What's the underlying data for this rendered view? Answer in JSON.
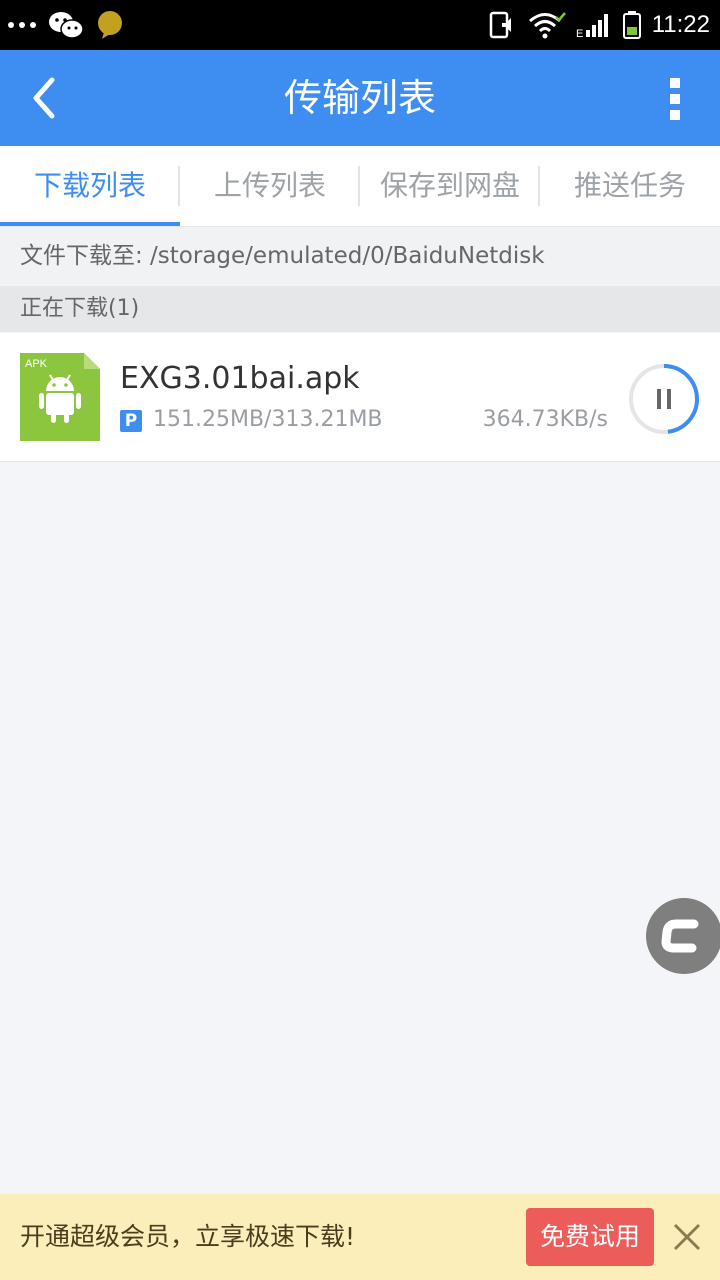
{
  "status_bar": {
    "time": "11:22",
    "icons": [
      "more-dots-icon",
      "wechat-icon",
      "chat-bubble-icon",
      "phone-vibrate-icon",
      "wifi-icon",
      "signal-icon",
      "battery-icon"
    ]
  },
  "app_bar": {
    "title": "传输列表",
    "back_icon": "back-arrow-icon",
    "menu_icon": "more-vertical-icon"
  },
  "tabs": [
    {
      "label": "下载列表",
      "active": true
    },
    {
      "label": "上传列表",
      "active": false
    },
    {
      "label": "保存到网盘",
      "active": false
    },
    {
      "label": "推送任务",
      "active": false
    }
  ],
  "download_path": "文件下载至: /storage/emulated/0/BaiduNetdisk",
  "section_title": "正在下载(1)",
  "downloads": [
    {
      "file_type_badge": "APK",
      "filename": "EXG3.01bai.apk",
      "badge": "P",
      "size_progress": "151.25MB/313.21MB",
      "speed": "364.73KB/s",
      "progress_fraction": 0.48
    }
  ],
  "banner": {
    "text": "开通超级会员，立享极速下载!",
    "button_label": "免费试用"
  },
  "colors": {
    "primary": "#3e8ef2",
    "banner_bg": "#fbeebb",
    "trial_button": "#ec5c5a",
    "apk_green": "#8cc63e"
  }
}
